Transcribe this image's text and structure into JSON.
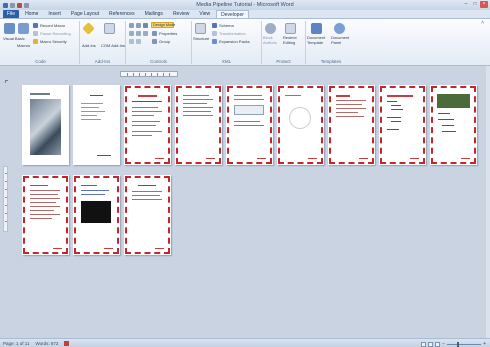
{
  "window": {
    "title": "Media Pipeline Tutorial - Microsoft Word"
  },
  "tabs": [
    {
      "label": "File"
    },
    {
      "label": "Home"
    },
    {
      "label": "Insert"
    },
    {
      "label": "Page Layout"
    },
    {
      "label": "References"
    },
    {
      "label": "Mailings"
    },
    {
      "label": "Review"
    },
    {
      "label": "View"
    },
    {
      "label": "Developer"
    }
  ],
  "active_tab": "Developer",
  "ribbon": {
    "code": {
      "label": "Code",
      "visual_basic": "Visual Basic",
      "macros": "Macros",
      "record_macro": "Record Macro",
      "pause_recording": "Pause Recording",
      "macro_security": "Macro Security"
    },
    "addins": {
      "label": "Add-Ins",
      "addins": "Add-Ins",
      "com_addins": "COM Add-Ins"
    },
    "controls": {
      "label": "Controls",
      "design_mode": "Design Mode",
      "properties": "Properties",
      "group": "Group"
    },
    "xml": {
      "label": "XML",
      "structure": "Structure",
      "schema": "Schema",
      "transformation": "Transformation",
      "expansion_packs": "Expansion Packs"
    },
    "protect": {
      "label": "Protect",
      "block_authors": "Block Authors",
      "restrict_editing": "Restrict Editing"
    },
    "templates": {
      "label": "Templates",
      "document_template": "Document Template",
      "document_panel": "Document Panel"
    }
  },
  "statusbar": {
    "page": "Page: 1 of 11",
    "words": "Words: 872"
  },
  "pages_count": 11,
  "colors": {
    "page_border": "#c1272d",
    "file_tab": "#2c5fa9",
    "workspace": "#c9d3e1"
  }
}
